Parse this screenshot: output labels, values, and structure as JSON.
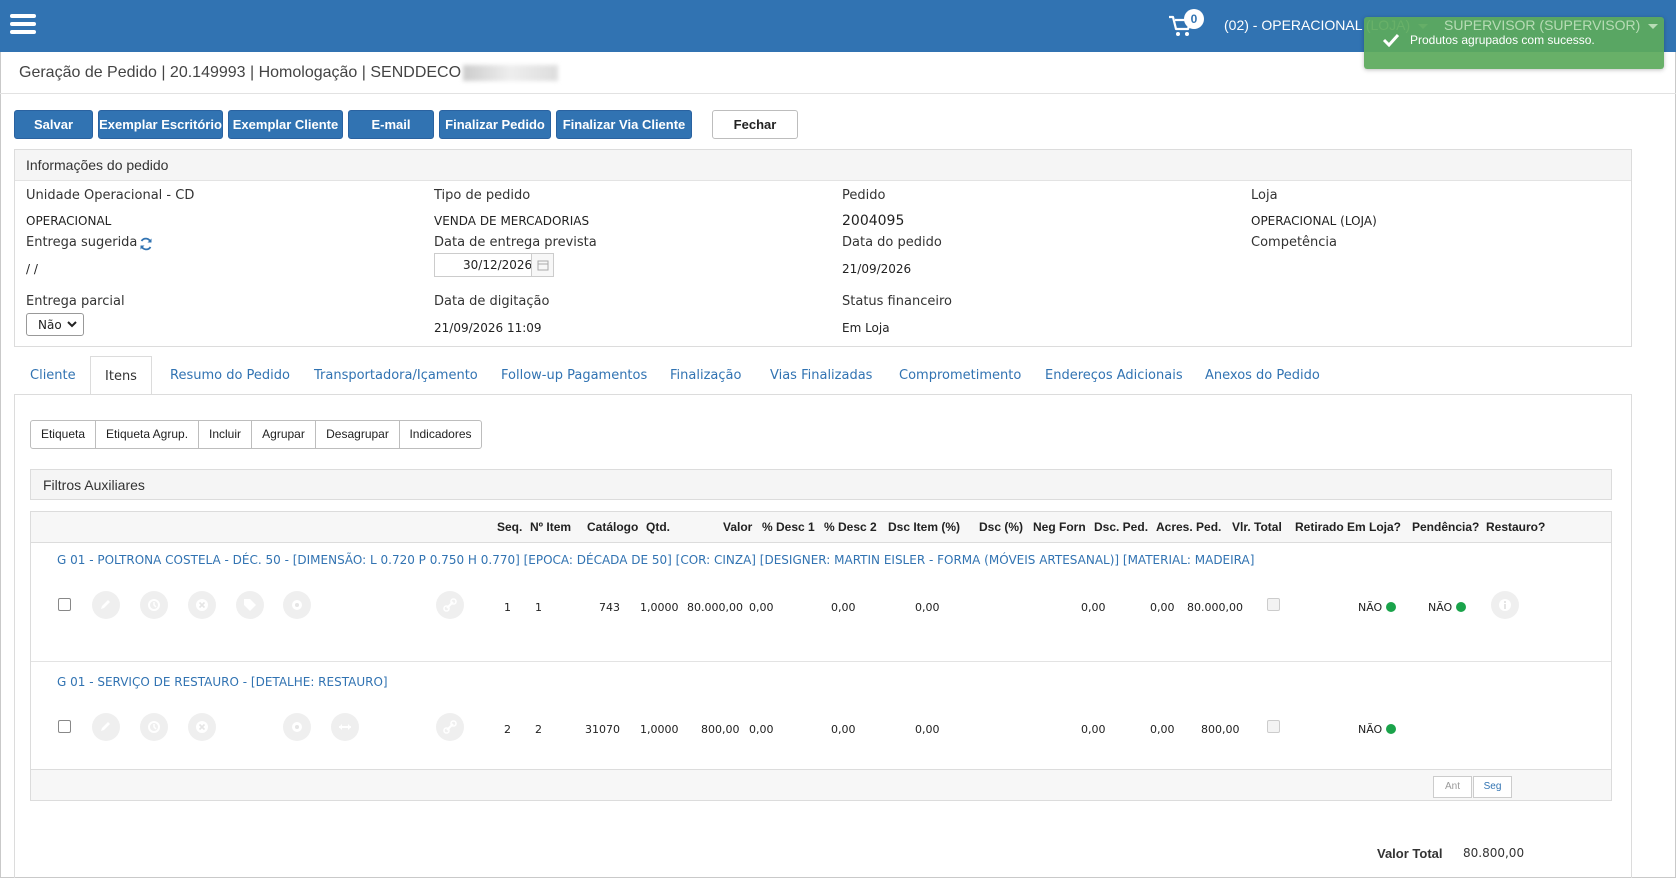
{
  "topbar": {
    "cart_count": "0",
    "unit": "(02) - OPERACIONAL (LOJA)",
    "user": "SUPERVISOR (SUPERVISOR)",
    "color": "#3173b2"
  },
  "toast": {
    "message": "Produtos agrupados com sucesso."
  },
  "page": {
    "title": "Geração de Pedido | 20.149993 | Homologação | SENDDECO"
  },
  "toolbar": {
    "salvar": "Salvar",
    "exemplar_escritorio": "Exemplar Escritório",
    "exemplar_cliente": "Exemplar Cliente",
    "email": "E-mail",
    "finalizar_pedido": "Finalizar Pedido",
    "finalizar_via_cliente": "Finalizar Via Cliente",
    "fechar": "Fechar"
  },
  "info": {
    "header": "Informações do pedido",
    "unidade_label": "Unidade Operacional - CD",
    "unidade_value": "OPERACIONAL",
    "tipo_label": "Tipo de pedido",
    "tipo_value": "VENDA DE MERCADORIAS",
    "pedido_label": "Pedido",
    "pedido_value": "2004095",
    "loja_label": "Loja",
    "loja_value": "OPERACIONAL (LOJA)",
    "entrega_sugerida_label": "Entrega sugerida",
    "entrega_sugerida_value": "/ /",
    "data_entrega_prevista_label": "Data de entrega prevista",
    "data_entrega_prevista_value": "30/12/2026",
    "data_pedido_label": "Data do pedido",
    "data_pedido_value": "21/09/2026",
    "competencia_label": "Competência",
    "entrega_parcial_label": "Entrega parcial",
    "entrega_parcial_value": "Não",
    "data_digitacao_label": "Data de digitação",
    "data_digitacao_value": "21/09/2026 11:09",
    "status_financeiro_label": "Status financeiro",
    "status_financeiro_value": "Em Loja"
  },
  "tabs": [
    "Cliente",
    "Itens",
    "Resumo do Pedido",
    "Transportadora/Içamento",
    "Follow-up Pagamentos",
    "Finalização",
    "Vias Finalizadas",
    "Comprometimento",
    "Endereços Adicionais",
    "Anexos do Pedido"
  ],
  "subtoolbar": [
    "Etiqueta",
    "Etiqueta Agrup.",
    "Incluir",
    "Agrupar",
    "Desagrupar",
    "Indicadores"
  ],
  "filtros": {
    "title": "Filtros Auxiliares"
  },
  "grid": {
    "columns": [
      "Seq.",
      "Nº Item",
      "Catálogo",
      "Qtd.",
      "Valor",
      "% Desc 1",
      "% Desc 2",
      "Dsc Item (%)",
      "Dsc (%)",
      "Neg Forn",
      "Dsc. Ped.",
      "Acres. Ped.",
      "Vlr. Total",
      "Retirado Em Loja?",
      "Pendência?",
      "Restauro?"
    ],
    "groups": [
      {
        "title": "G 01 - POLTRONA COSTELA - DÉC. 50 - [DIMENSÃO: L 0.720 P 0.750 H 0.770] [EPOCA: DÉCADA DE 50] [COR: CINZA] [DESIGNER: MARTIN EISLER - FORMA (MÓVEIS ARTESANAL)] [MATERIAL: MADEIRA]",
        "seq": "1",
        "item": "1",
        "catalogo": "743",
        "qtd": "1,0000",
        "valor": "80.000,00",
        "desc1": "0,00",
        "desc2": "0,00",
        "dsc_item": "0,00",
        "dsc_ped": "0,00",
        "acres_ped": "0,00",
        "vlr_total": "80.000,00",
        "pendencia": "NÃO",
        "restauro": "NÃO"
      },
      {
        "title": "G 01 - SERVIÇO DE RESTAURO - [DETALHE: RESTAURO]",
        "seq": "2",
        "item": "2",
        "catalogo": "31070",
        "qtd": "1,0000",
        "valor": "800,00",
        "desc1": "0,00",
        "desc2": "0,00",
        "dsc_item": "0,00",
        "dsc_ped": "0,00",
        "acres_ped": "0,00",
        "vlr_total": "800,00",
        "pendencia": "NÃO"
      }
    ],
    "pager": {
      "prev": "Ant",
      "next": "Seg"
    }
  },
  "totals": {
    "label": "Valor Total",
    "value": "80.800,00"
  },
  "icons": {
    "menu": "hamburger-icon",
    "cart": "cart-icon",
    "check": "check-icon",
    "refresh": "refresh-icon",
    "calendar": "calendar-icon",
    "edit": "pencil-icon",
    "history": "history-icon",
    "remove": "close-icon",
    "tag": "tag-icon",
    "settings": "gear-icon",
    "link": "link-icon",
    "expand": "arrows-horizontal-icon",
    "info": "info-icon"
  }
}
